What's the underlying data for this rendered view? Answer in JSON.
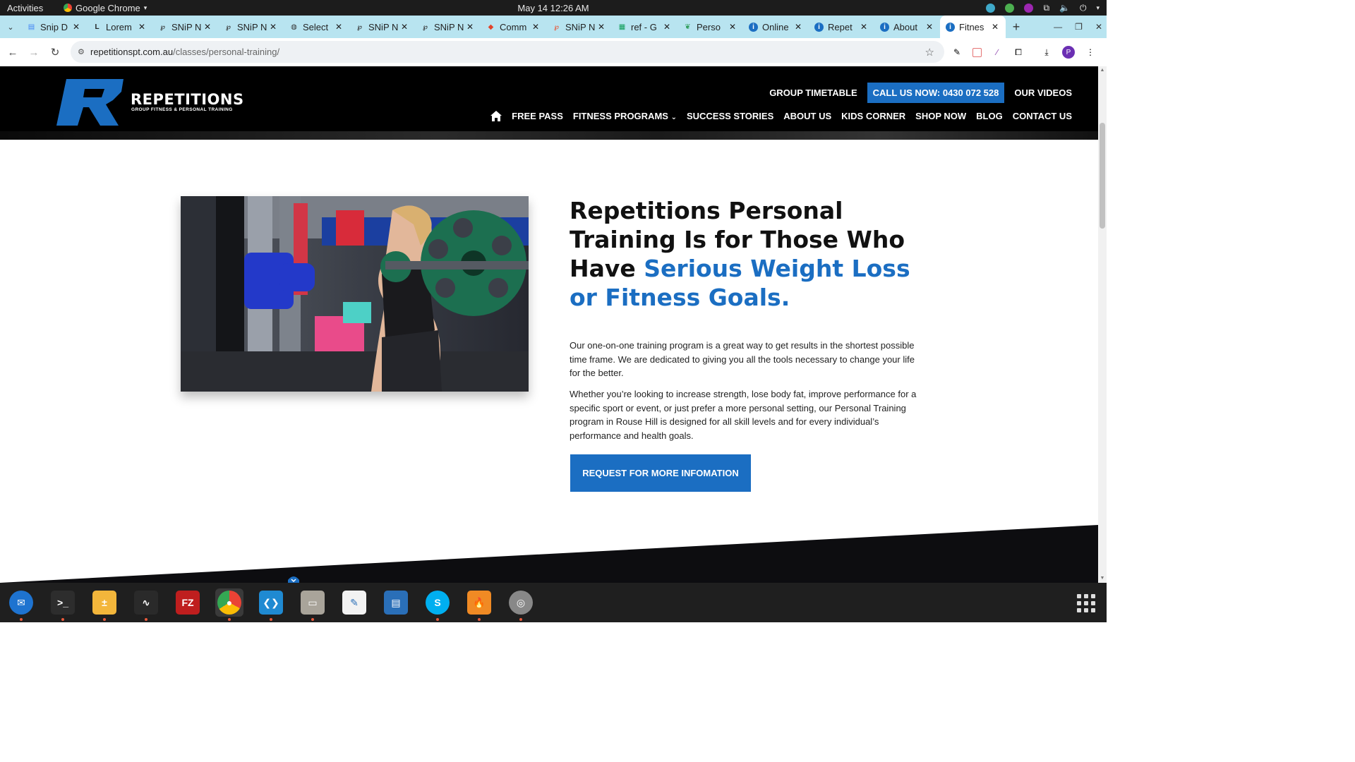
{
  "system": {
    "activities": "Activities",
    "app_name": "Google Chrome",
    "clock": "May 14  12:26 AM"
  },
  "tabs": [
    {
      "title": "Snip D",
      "icon": "docs-icon",
      "color": "#4285f4"
    },
    {
      "title": "Lorem",
      "icon": "lorem-icon",
      "color": "#222222"
    },
    {
      "title": "SNiP N",
      "icon": "snip-icon",
      "color": "#333333"
    },
    {
      "title": "SNiP N",
      "icon": "snip-icon",
      "color": "#333333"
    },
    {
      "title": "Select",
      "icon": "globe-icon",
      "color": "#333333"
    },
    {
      "title": "SNiP N",
      "icon": "snip-icon",
      "color": "#333333"
    },
    {
      "title": "SNiP N",
      "icon": "snip-icon",
      "color": "#333333"
    },
    {
      "title": "Comm",
      "icon": "gitlab-icon",
      "color": "#e24329"
    },
    {
      "title": "SNiP N",
      "icon": "snip-icon",
      "color": "#e8593b"
    },
    {
      "title": "ref - G",
      "icon": "sheets-icon",
      "color": "#0f9d58"
    },
    {
      "title": "Perso",
      "icon": "leaf-icon",
      "color": "#2e9d5a"
    },
    {
      "title": "Online",
      "icon": "info-icon",
      "color": "#1b6ec2"
    },
    {
      "title": "Repet",
      "icon": "info-icon",
      "color": "#1b6ec2"
    },
    {
      "title": "About",
      "icon": "info-icon",
      "color": "#1b6ec2"
    },
    {
      "title": "Fitnes",
      "icon": "info-icon",
      "color": "#1b6ec2",
      "active": true
    }
  ],
  "address": {
    "domain": "repetitionspt.com.au",
    "path": "/classes/personal-training/"
  },
  "site": {
    "logo_word": "REPETITIONS",
    "logo_tag": "GROUP FITNESS & PERSONAL TRAINING",
    "top_links": {
      "timetable": "GROUP TIMETABLE",
      "call": "CALL US NOW: 0430 072 528",
      "videos": "OUR VIDEOS"
    },
    "nav": {
      "free_pass": "FREE PASS",
      "programs": "FITNESS PROGRAMS",
      "success": "SUCCESS STORIES",
      "about": "ABOUT US",
      "kids": "KIDS CORNER",
      "shop": "SHOP NOW",
      "blog": "BLOG",
      "contact": "CONTACT US"
    },
    "headline_plain": "Repetitions Personal Training Is for Those Who Have ",
    "headline_accent": "Serious Weight Loss or Fitness Goals.",
    "para1": "Our one-on-one training program is a great way to get results in the shortest possible time frame. We are dedicated to giving you all the tools necessary to change your life for the better.",
    "para2": "Whether you’re looking to increase strength, lose body fat, improve performance for a specific sport or event, or just prefer a more personal setting, our Personal Training program in Rouse Hill is designed for all skill levels and for every individual’s performance and health goals.",
    "cta": "REQUEST FOR MORE INFOMATION",
    "colors": {
      "brand_blue": "#1b6ec2",
      "header_bg": "#000000"
    }
  },
  "dock": [
    "thunderbird-icon",
    "terminal-icon",
    "calculator-icon",
    "system-monitor-icon",
    "filezilla-icon",
    "chrome-icon",
    "vscode-icon",
    "files-icon",
    "text-editor-icon",
    "libreoffice-writer-icon",
    "skype-icon",
    "app-flame-icon",
    "disk-icon"
  ]
}
